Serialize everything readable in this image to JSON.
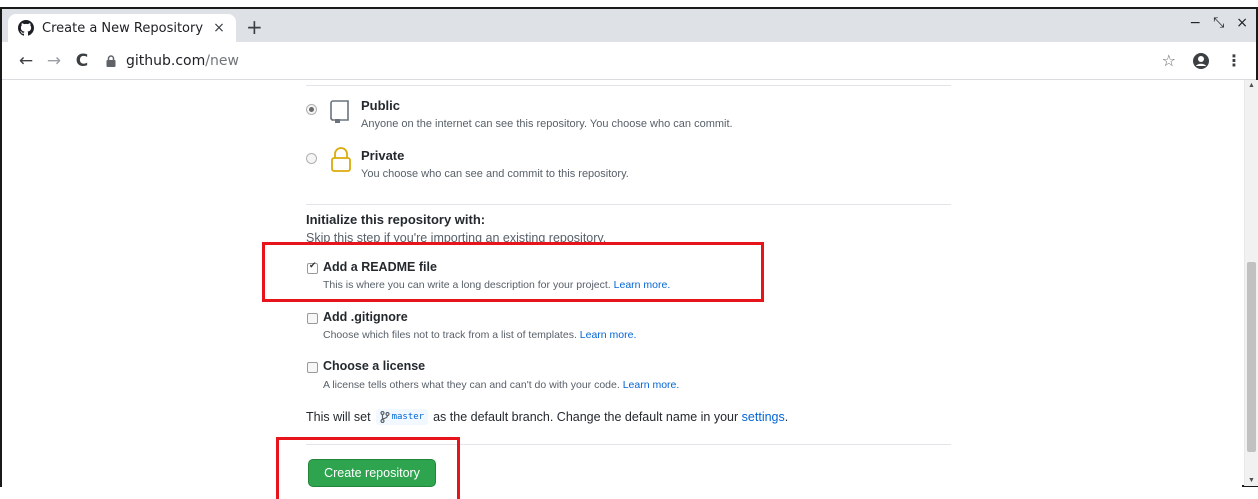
{
  "browser": {
    "tab_title": "Create a New Repository",
    "tab_close": "×",
    "new_tab": "+",
    "url_host": "github.com",
    "url_path": "/new",
    "window_controls": [
      "−",
      "⤡",
      "×"
    ]
  },
  "visibility": {
    "options": [
      {
        "title": "Public",
        "desc": "Anyone on the internet can see this repository. You choose who can commit.",
        "selected": true,
        "icon": "repo-icon"
      },
      {
        "title": "Private",
        "desc": "You choose who can see and commit to this repository.",
        "selected": false,
        "icon": "lock-icon"
      }
    ]
  },
  "init": {
    "title": "Initialize this repository with:",
    "subtitle": "Skip this step if you're importing an existing repository.",
    "readme": {
      "label": "Add a README file",
      "desc": "This is where you can write a long description for your project.",
      "link": "Learn more.",
      "checked": true
    },
    "gitignore": {
      "label": "Add .gitignore",
      "desc": "Choose which files not to track from a list of templates.",
      "link": "Learn more.",
      "checked": false
    },
    "license": {
      "label": "Choose a license",
      "desc": "A license tells others what they can and can't do with your code.",
      "link": "Learn more.",
      "checked": false
    }
  },
  "branch": {
    "prefix": "This will set",
    "name": "master",
    "suffix": "as the default branch. Change the default name in your",
    "settings_link": "settings",
    "end": "."
  },
  "submit": {
    "label": "Create repository"
  },
  "colors": {
    "accent_green": "#2ea44f",
    "link_blue": "#0366d6",
    "highlight_red": "#e8141b",
    "lock_gold": "#dbab09"
  }
}
